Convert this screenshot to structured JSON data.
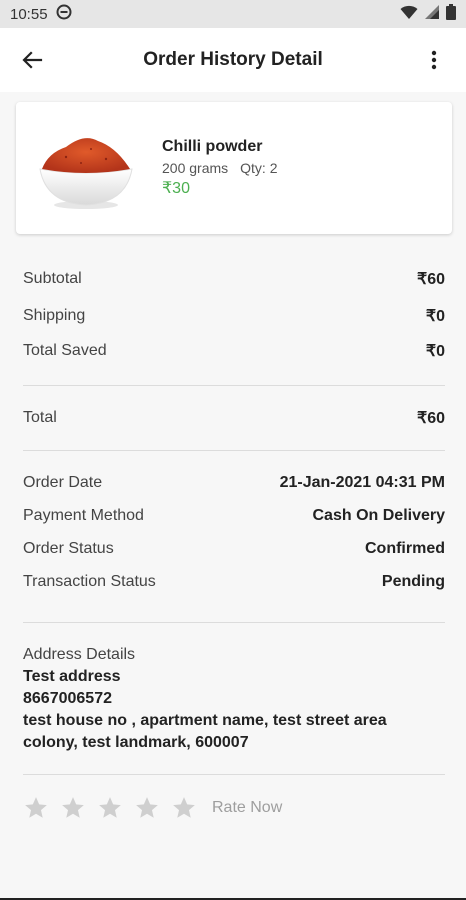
{
  "status_bar": {
    "time": "10:55",
    "icons": [
      "dnd-icon",
      "wifi-icon",
      "signal-icon",
      "battery-icon"
    ]
  },
  "app_bar": {
    "title": "Order History Detail",
    "back_icon": "back-arrow-icon",
    "menu_icon": "more-vert-icon"
  },
  "product": {
    "name": "Chilli powder",
    "weight": "200 grams",
    "qty": "Qty: 2",
    "price": "₹30",
    "image": "chilli-powder-bowl-image"
  },
  "totals": [
    {
      "label": "Subtotal",
      "value": "₹60"
    },
    {
      "label": "Shipping",
      "value": "₹0"
    },
    {
      "label": "Total Saved",
      "value": "₹0"
    }
  ],
  "grand_total": {
    "label": "Total",
    "value": "₹60"
  },
  "order_info": [
    {
      "label": "Order Date",
      "value": "21-Jan-2021 04:31 PM"
    },
    {
      "label": "Payment Method",
      "value": "Cash On Delivery"
    },
    {
      "label": "Order Status",
      "value": "Confirmed"
    },
    {
      "label": "Transaction Status",
      "value": "Pending"
    }
  ],
  "address": {
    "title": "Address Details",
    "name": "Test address",
    "phone": "8667006572",
    "line1": "test house no , apartment name, test street area",
    "line2": "colony, test landmark, 600007"
  },
  "rating": {
    "stars": 5,
    "value": 0,
    "cta": "Rate Now"
  },
  "colors": {
    "price_green": "#4caf50",
    "star_gray": "#cfcfcf",
    "status_bar_bg": "#e6e6e6"
  }
}
